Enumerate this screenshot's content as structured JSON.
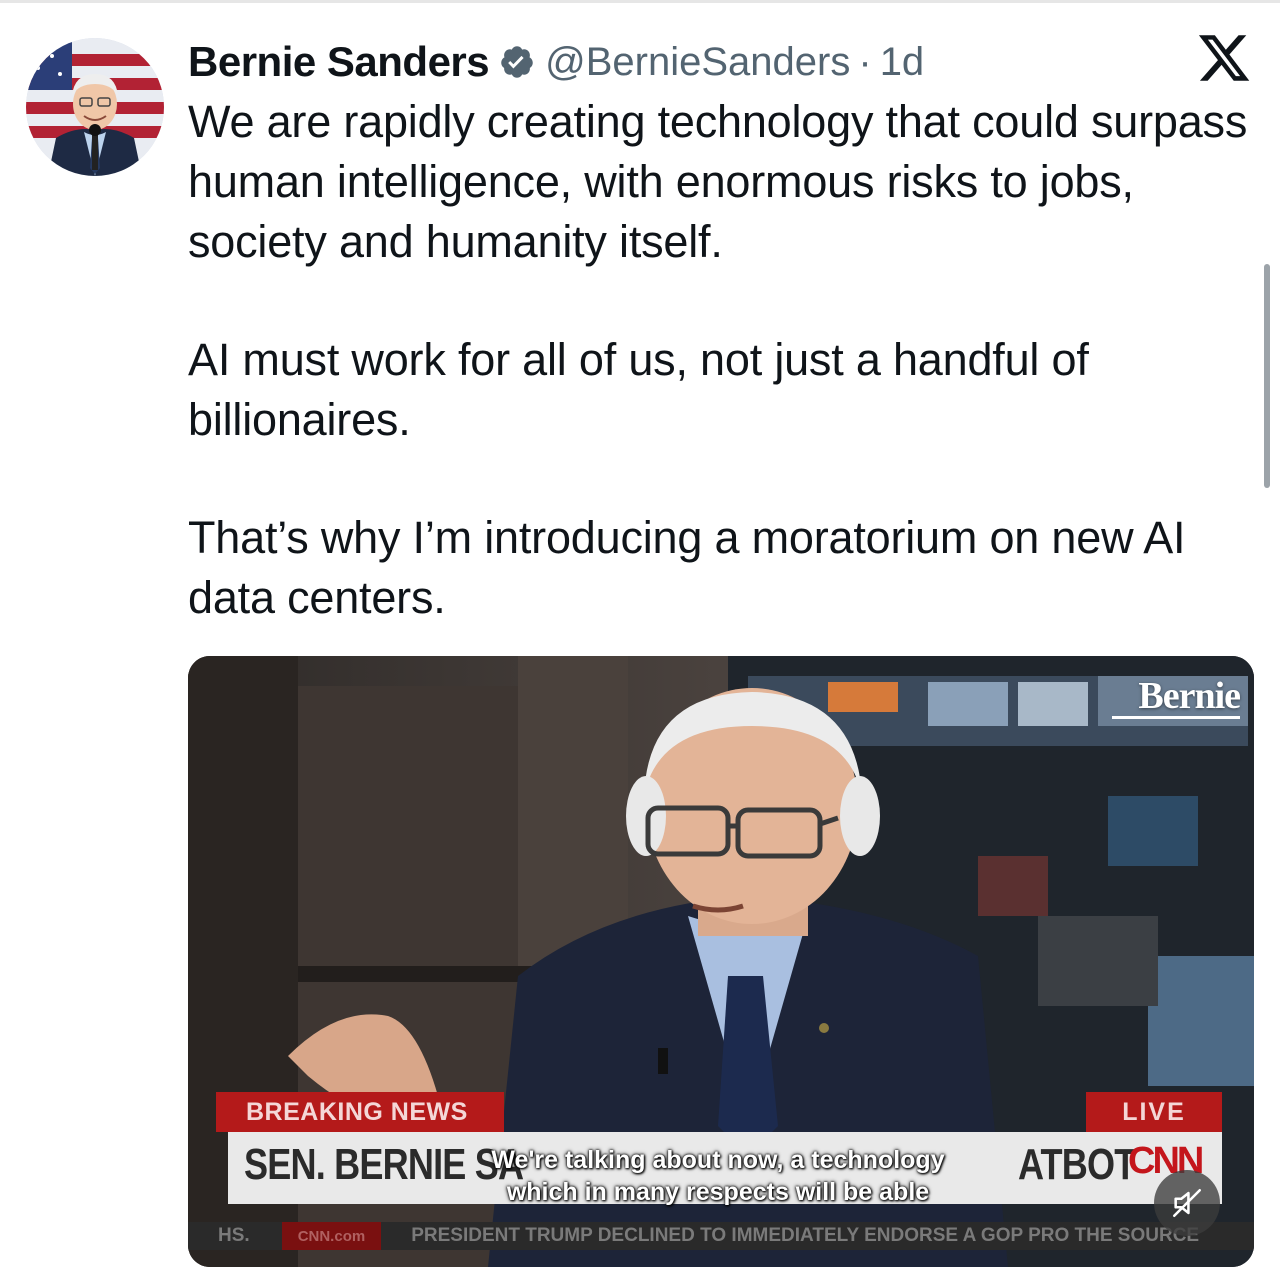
{
  "author": {
    "display_name": "Bernie Sanders",
    "handle": "@BernieSanders",
    "separator": "·",
    "age": "1d",
    "verified": true
  },
  "tweet": {
    "paragraphs": [
      "We are rapidly creating technology that could surpass human intelligence, with enormous risks to jobs, society and humanity itself.",
      "AI must work for all of us, not just a handful of billionaires.",
      "That’s why I’m introducing a moratorium on new AI data centers."
    ]
  },
  "video": {
    "watermark": "Bernie",
    "breaking_label": "BREAKING NEWS",
    "live_label": "LIVE",
    "headline_left": "SEN. BERNIE SA",
    "headline_right": "ATBOT",
    "network": "CNN",
    "caption_line1": "We're talking about now, a technology",
    "caption_line2": "which in many respects will be able",
    "ticker_prefix": "HS.",
    "ticker_site": "CNN.com",
    "ticker_text": "PRESIDENT TRUMP DECLINED TO IMMEDIATELY ENDORSE A GOP PRO THE SOURCE",
    "muted": true
  },
  "icons": {
    "verified": "verified-badge-icon",
    "platform": "x-logo-icon",
    "mute": "volume-muted-icon"
  },
  "colors": {
    "text": "#0f1419",
    "secondary": "#536471",
    "verified": "#536471",
    "breaking": "#b41a1a"
  }
}
